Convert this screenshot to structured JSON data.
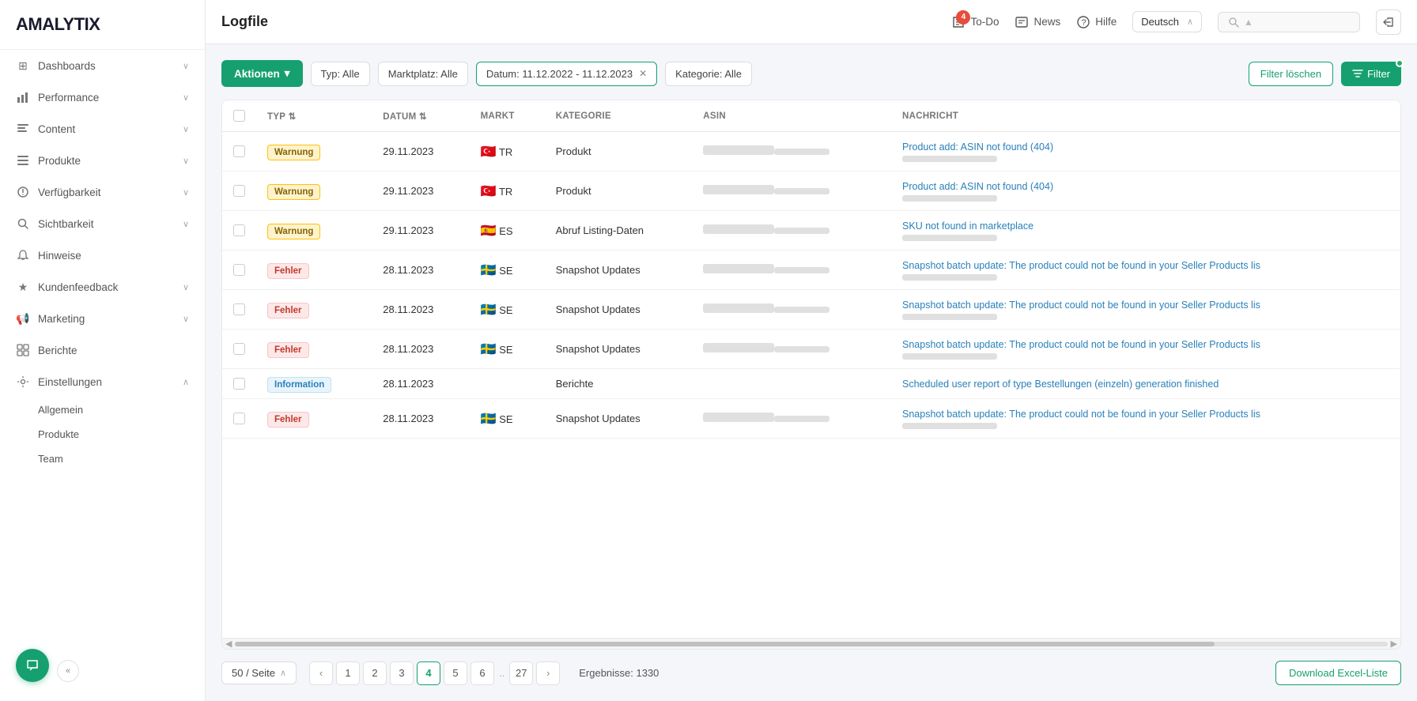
{
  "app": {
    "logo": "AMALYTIX"
  },
  "sidebar": {
    "items": [
      {
        "id": "dashboards",
        "label": "Dashboards",
        "icon": "⊞",
        "hasChevron": true,
        "expanded": false
      },
      {
        "id": "performance",
        "label": "Performance",
        "icon": "📊",
        "hasChevron": true,
        "expanded": true
      },
      {
        "id": "content",
        "label": "Content",
        "icon": "📄",
        "hasChevron": true,
        "expanded": false
      },
      {
        "id": "produkte",
        "label": "Produkte",
        "icon": "☰",
        "hasChevron": true,
        "expanded": false
      },
      {
        "id": "verfuegbarkeit",
        "label": "Verfügbarkeit",
        "icon": "🔔",
        "hasChevron": true,
        "expanded": false
      },
      {
        "id": "sichtbarkeit",
        "label": "Sichtbarkeit",
        "icon": "🔍",
        "hasChevron": true,
        "expanded": false
      },
      {
        "id": "hinweise",
        "label": "Hinweise",
        "icon": "🔔",
        "hasChevron": false,
        "expanded": false
      },
      {
        "id": "kundenfeedback",
        "label": "Kundenfeedback",
        "icon": "★",
        "hasChevron": true,
        "expanded": false
      },
      {
        "id": "marketing",
        "label": "Marketing",
        "icon": "📢",
        "hasChevron": true,
        "expanded": false
      },
      {
        "id": "berichte",
        "label": "Berichte",
        "icon": "⊞",
        "hasChevron": false,
        "expanded": false
      },
      {
        "id": "einstellungen",
        "label": "Einstellungen",
        "icon": "⚙",
        "hasChevron": true,
        "expanded": true
      }
    ],
    "sub_items": [
      {
        "id": "allgemein",
        "label": "Allgemein"
      },
      {
        "id": "produkte-sub",
        "label": "Produkte"
      },
      {
        "id": "team",
        "label": "Team"
      }
    ]
  },
  "header": {
    "title": "Logfile",
    "todo_label": "To-Do",
    "todo_badge": "4",
    "news_label": "News",
    "hilfe_label": "Hilfe",
    "language": "Deutsch",
    "search_placeholder": ""
  },
  "toolbar": {
    "actions_label": "Aktionen",
    "filters": [
      {
        "id": "typ",
        "label": "Typ: Alle"
      },
      {
        "id": "marktplatz",
        "label": "Marktplatz: Alle"
      },
      {
        "id": "datum",
        "label": "Datum: 11.12.2022 - 11.12.2023",
        "removable": true
      },
      {
        "id": "kategorie",
        "label": "Kategorie: Alle"
      }
    ],
    "clear_filter_label": "Filter löschen",
    "filter_label": "Filter"
  },
  "table": {
    "columns": [
      {
        "id": "checkbox",
        "label": ""
      },
      {
        "id": "typ",
        "label": "TYP",
        "sortable": true
      },
      {
        "id": "datum",
        "label": "DATUM",
        "sortable": true
      },
      {
        "id": "markt",
        "label": "MARKT"
      },
      {
        "id": "kategorie",
        "label": "KATEGORIE"
      },
      {
        "id": "asin",
        "label": "ASIN"
      },
      {
        "id": "nachricht",
        "label": "NACHRICHT"
      }
    ],
    "rows": [
      {
        "type": "Warnung",
        "type_class": "badge-warn",
        "datum": "29.11.2023",
        "flag": "🇹🇷",
        "markt": "TR",
        "kategorie": "Produkt",
        "asin_blur": true,
        "nachricht": "Product add: ASIN not found (404)",
        "nachricht_sub": true
      },
      {
        "type": "Warnung",
        "type_class": "badge-warn",
        "datum": "29.11.2023",
        "flag": "🇹🇷",
        "markt": "TR",
        "kategorie": "Produkt",
        "asin_blur": true,
        "nachricht": "Product add: ASIN not found (404)",
        "nachricht_sub": true
      },
      {
        "type": "Warnung",
        "type_class": "badge-warn",
        "datum": "29.11.2023",
        "flag": "🇪🇸",
        "markt": "ES",
        "kategorie": "Abruf Listing-Daten",
        "asin_blur": true,
        "nachricht": "SKU not found in marketplace",
        "nachricht_sub": true
      },
      {
        "type": "Fehler",
        "type_class": "badge-error",
        "datum": "28.11.2023",
        "flag": "🇸🇪",
        "markt": "SE",
        "kategorie": "Snapshot Updates",
        "asin_blur": true,
        "nachricht": "Snapshot batch update: The product could not be found in your Seller Products lis",
        "nachricht_sub": true
      },
      {
        "type": "Fehler",
        "type_class": "badge-error",
        "datum": "28.11.2023",
        "flag": "🇸🇪",
        "markt": "SE",
        "kategorie": "Snapshot Updates",
        "asin_blur": true,
        "nachricht": "Snapshot batch update: The product could not be found in your Seller Products lis",
        "nachricht_sub": true
      },
      {
        "type": "Fehler",
        "type_class": "badge-error",
        "datum": "28.11.2023",
        "flag": "🇸🇪",
        "markt": "SE",
        "kategorie": "Snapshot Updates",
        "asin_blur": true,
        "nachricht": "Snapshot batch update: The product could not be found in your Seller Products lis",
        "nachricht_sub": true
      },
      {
        "type": "Information",
        "type_class": "badge-info",
        "datum": "28.11.2023",
        "flag": "",
        "markt": "",
        "kategorie": "Berichte",
        "asin_blur": false,
        "nachricht": "Scheduled user report of type Bestellungen (einzeln) generation finished",
        "nachricht_sub": false
      },
      {
        "type": "Fehler",
        "type_class": "badge-error",
        "datum": "28.11.2023",
        "flag": "🇸🇪",
        "markt": "SE",
        "kategorie": "Snapshot Updates",
        "asin_blur": true,
        "nachricht": "Snapshot batch update: The product could not be found in your Seller Products lis",
        "nachricht_sub": true
      }
    ]
  },
  "pagination": {
    "page_size": "50 / Seite",
    "pages": [
      "1",
      "2",
      "3",
      "4",
      "5",
      "6",
      "..",
      "27"
    ],
    "current_page": "4",
    "results_label": "Ergebnisse: 1330",
    "download_label": "Download Excel-Liste"
  }
}
